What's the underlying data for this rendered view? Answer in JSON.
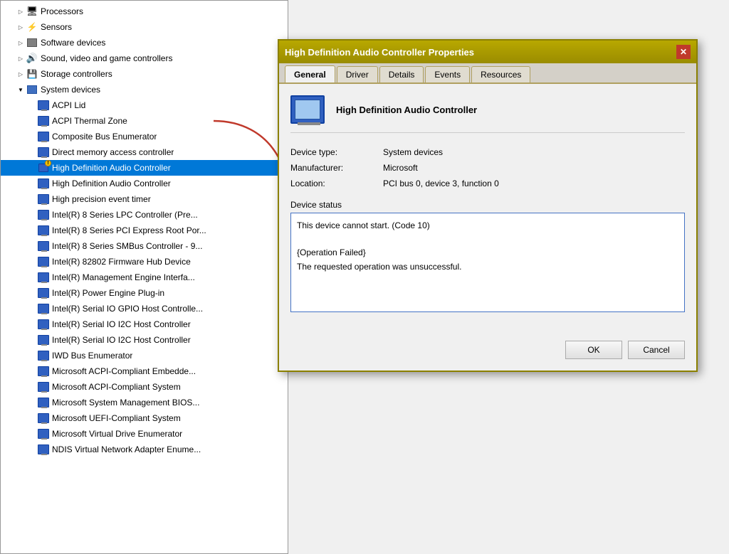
{
  "deviceManager": {
    "treeItems": [
      {
        "id": "processors",
        "label": "Processors",
        "indent": 1,
        "type": "group",
        "expanded": false
      },
      {
        "id": "sensors",
        "label": "Sensors",
        "indent": 1,
        "type": "group",
        "expanded": false
      },
      {
        "id": "software-devices",
        "label": "Software devices",
        "indent": 1,
        "type": "group",
        "expanded": false
      },
      {
        "id": "sound-video",
        "label": "Sound, video and game controllers",
        "indent": 1,
        "type": "group",
        "expanded": false
      },
      {
        "id": "storage-controllers",
        "label": "Storage controllers",
        "indent": 1,
        "type": "group",
        "expanded": false
      },
      {
        "id": "system-devices",
        "label": "System devices",
        "indent": 1,
        "type": "group",
        "expanded": true
      },
      {
        "id": "acpi-lid",
        "label": "ACPI Lid",
        "indent": 2,
        "type": "device"
      },
      {
        "id": "acpi-thermal",
        "label": "ACPI Thermal Zone",
        "indent": 2,
        "type": "device"
      },
      {
        "id": "composite-bus",
        "label": "Composite Bus Enumerator",
        "indent": 2,
        "type": "device"
      },
      {
        "id": "direct-memory",
        "label": "Direct memory access controller",
        "indent": 2,
        "type": "device"
      },
      {
        "id": "hd-audio-warn",
        "label": "High Definition Audio Controller",
        "indent": 2,
        "type": "device-warning",
        "selected": true
      },
      {
        "id": "hd-audio",
        "label": "High Definition Audio Controller",
        "indent": 2,
        "type": "device"
      },
      {
        "id": "high-precision",
        "label": "High precision event timer",
        "indent": 2,
        "type": "device"
      },
      {
        "id": "intel-lpc",
        "label": "Intel(R) 8 Series LPC Controller (Pre...",
        "indent": 2,
        "type": "device"
      },
      {
        "id": "intel-pci",
        "label": "Intel(R) 8 Series PCI Express Root Por...",
        "indent": 2,
        "type": "device"
      },
      {
        "id": "intel-smbus",
        "label": "Intel(R) 8 Series SMBus Controller - 9...",
        "indent": 2,
        "type": "device"
      },
      {
        "id": "intel-firmware",
        "label": "Intel(R) 82802 Firmware Hub Device",
        "indent": 2,
        "type": "device"
      },
      {
        "id": "intel-mgmt",
        "label": "Intel(R) Management Engine Interfa...",
        "indent": 2,
        "type": "device"
      },
      {
        "id": "intel-power",
        "label": "Intel(R) Power Engine Plug-in",
        "indent": 2,
        "type": "device"
      },
      {
        "id": "intel-serial-gpio",
        "label": "Intel(R) Serial IO GPIO Host Controlle...",
        "indent": 2,
        "type": "device"
      },
      {
        "id": "intel-serial-i2c1",
        "label": "Intel(R) Serial IO I2C Host Controller",
        "indent": 2,
        "type": "device"
      },
      {
        "id": "intel-serial-i2c2",
        "label": "Intel(R) Serial IO I2C Host Controller",
        "indent": 2,
        "type": "device"
      },
      {
        "id": "iwd-bus",
        "label": "IWD Bus Enumerator",
        "indent": 2,
        "type": "device"
      },
      {
        "id": "ms-acpi-embedded",
        "label": "Microsoft ACPI-Compliant Embedde...",
        "indent": 2,
        "type": "device"
      },
      {
        "id": "ms-acpi-system",
        "label": "Microsoft ACPI-Compliant System",
        "indent": 2,
        "type": "device"
      },
      {
        "id": "ms-system-mgmt",
        "label": "Microsoft System Management BIOS...",
        "indent": 2,
        "type": "device"
      },
      {
        "id": "ms-uefi",
        "label": "Microsoft UEFI-Compliant System",
        "indent": 2,
        "type": "device"
      },
      {
        "id": "ms-virtual-drive",
        "label": "Microsoft Virtual Drive Enumerator",
        "indent": 2,
        "type": "device"
      },
      {
        "id": "ndis-virtual",
        "label": "NDIS Virtual Network Adapter Enume...",
        "indent": 2,
        "type": "device"
      }
    ]
  },
  "dialog": {
    "title": "High Definition Audio Controller Properties",
    "tabs": [
      "General",
      "Driver",
      "Details",
      "Events",
      "Resources"
    ],
    "activeTab": "General",
    "deviceName": "High Definition Audio Controller",
    "properties": {
      "deviceTypeLabel": "Device type:",
      "deviceTypeValue": "System devices",
      "manufacturerLabel": "Manufacturer:",
      "manufacturerValue": "Microsoft",
      "locationLabel": "Location:",
      "locationValue": "PCI bus 0, device 3, function 0"
    },
    "statusSection": {
      "label": "Device status",
      "statusText": "This device cannot start. (Code 10)\n\n{Operation Failed}\nThe requested operation was unsuccessful."
    },
    "buttons": {
      "ok": "OK",
      "cancel": "Cancel"
    }
  }
}
